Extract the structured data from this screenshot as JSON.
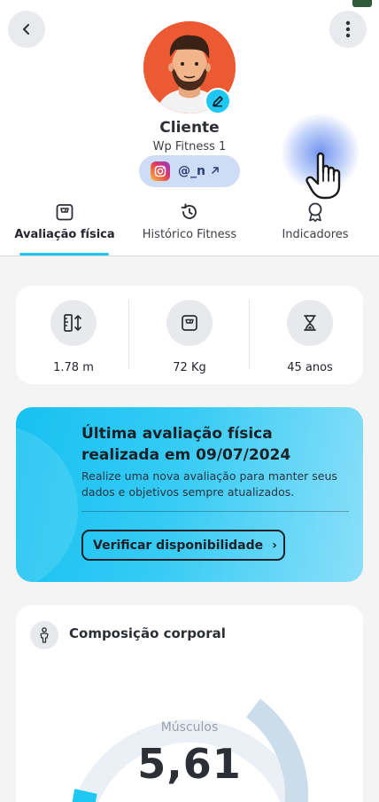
{
  "profile": {
    "name": "Cliente",
    "subtitle": "Wp Fitness 1",
    "instagram_handle": "@_n"
  },
  "tabs": [
    {
      "label": "Avaliação física",
      "icon": "scale-icon",
      "active": true
    },
    {
      "label": "Histórico Fitness",
      "icon": "history-icon",
      "active": false
    },
    {
      "label": "Indicadores",
      "icon": "award-icon",
      "active": false
    }
  ],
  "metrics": [
    {
      "value": "1.78 m",
      "icon": "height-icon"
    },
    {
      "value": "72 Kg",
      "icon": "weight-scale-icon"
    },
    {
      "value": "45 anos",
      "icon": "hourglass-icon"
    }
  ],
  "evaluation": {
    "title": "Última avaliação física realizada em  09/07/2024",
    "description": "Realize uma nova avaliação para manter seus dados e objetivos sempre atualizados.",
    "button_label": "Verificar disponibilidade",
    "button_chevron": "›"
  },
  "composition": {
    "title": "Composição corporal",
    "gauge_label": "Músculos",
    "gauge_value": "5,61"
  },
  "colors": {
    "accent": "#1ec8f2",
    "avatar_bg": "#ec5a33",
    "instagram_pill": "#cfdcf6",
    "gauge_track": "#eaf0f6",
    "gauge_segment": "#cbdcea"
  }
}
